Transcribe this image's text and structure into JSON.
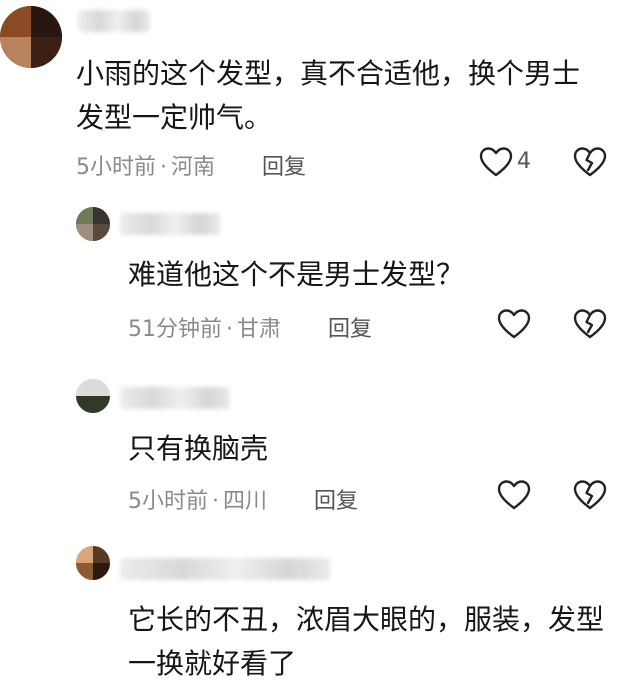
{
  "comments": [
    {
      "text": "小雨的这个发型，真不合适他，换个男士\n发型一定帅气。",
      "time": "5小时前",
      "location": "河南",
      "reply_label": "回复",
      "like_count": "4"
    },
    {
      "text": "难道他这个不是男士发型？",
      "time": "51分钟前",
      "location": "甘肃",
      "reply_label": "回复"
    },
    {
      "text": "只有换脑壳",
      "time": "5小时前",
      "location": "四川",
      "reply_label": "回复"
    },
    {
      "text": "它长的不丑，浓眉大眼的，服装，发型\n一换就好看了"
    }
  ],
  "meta_separator": "·",
  "icons": {
    "like": "heart-outline-icon",
    "dislike": "broken-heart-icon"
  },
  "colors": {
    "text": "#161616",
    "meta": "#8a8a8a",
    "icon_stroke": "#222222"
  }
}
